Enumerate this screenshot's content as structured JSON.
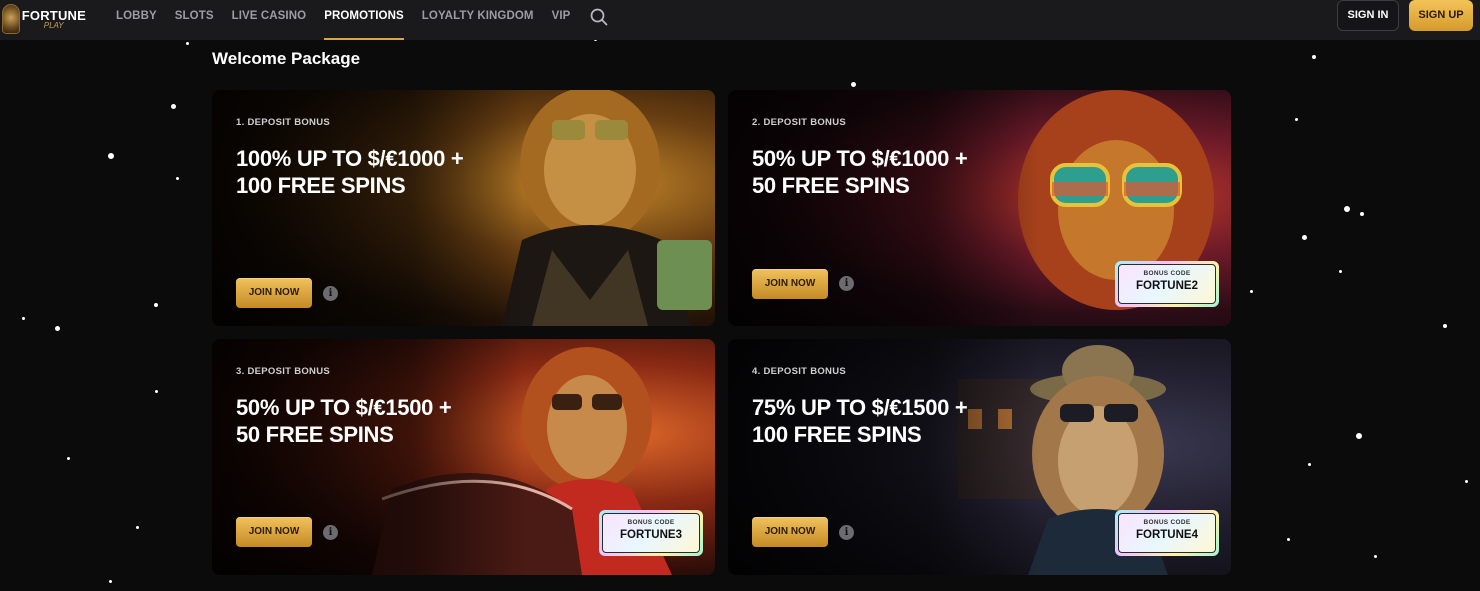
{
  "header": {
    "logo_top": "FORTUNE",
    "logo_bottom": "PLAY",
    "nav": [
      {
        "label": "LOBBY"
      },
      {
        "label": "SLOTS"
      },
      {
        "label": "LIVE CASINO"
      },
      {
        "label": "PROMOTIONS"
      },
      {
        "label": "LOYALTY KINGDOM"
      },
      {
        "label": "VIP"
      }
    ],
    "active_nav": "PROMOTIONS",
    "sign_in": "SIGN IN",
    "sign_up": "SIGN UP"
  },
  "section": {
    "title": "Welcome Package",
    "cards": [
      {
        "eyebrow": "1. DEPOSIT BONUS",
        "line1": "100% UP TO $/€1000 +",
        "line2": "100 FREE SPINS",
        "cta": "JOIN NOW",
        "bonus_code_label": "",
        "bonus_code": ""
      },
      {
        "eyebrow": "2. DEPOSIT BONUS",
        "line1": "50% UP TO $/€1000 +",
        "line2": "50 FREE SPINS",
        "cta": "JOIN NOW",
        "bonus_code_label": "BONUS CODE",
        "bonus_code": "FORTUNE2"
      },
      {
        "eyebrow": "3. DEPOSIT BONUS",
        "line1": "50% UP TO $/€1500 +",
        "line2": "50 FREE SPINS",
        "cta": "JOIN NOW",
        "bonus_code_label": "BONUS CODE",
        "bonus_code": "FORTUNE3"
      },
      {
        "eyebrow": "4. DEPOSIT BONUS",
        "line1": "75% UP TO $/€1500 +",
        "line2": "100 FREE SPINS",
        "cta": "JOIN NOW",
        "bonus_code_label": "BONUS CODE",
        "bonus_code": "FORTUNE4"
      }
    ]
  },
  "icons": {
    "search": "search-icon",
    "info": "info-icon"
  },
  "colors": {
    "accent_gold": "#d9a741",
    "background": "#0b0b0c",
    "topbar": "#1a1a1c"
  }
}
